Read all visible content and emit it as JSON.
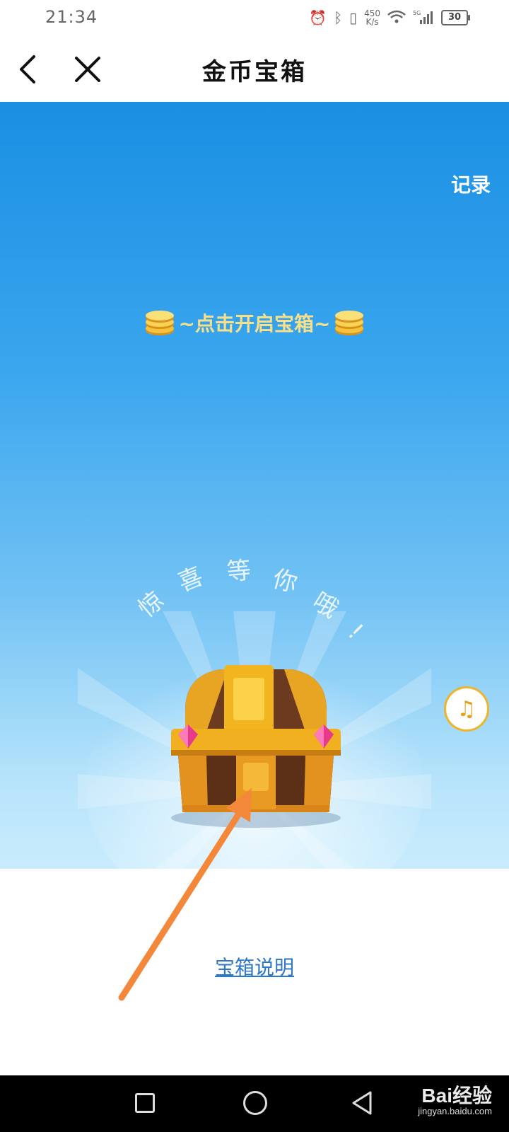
{
  "status_bar": {
    "time": "21:34",
    "net_speed_value": "450",
    "net_speed_unit": "K/s",
    "signal_label": "5G",
    "battery": "30",
    "icons": [
      "alarm-icon",
      "bluetooth-icon",
      "vibrate-icon",
      "wifi-icon",
      "signal-icon",
      "battery-icon"
    ]
  },
  "nav": {
    "title": "金币宝箱",
    "back_icon": "chevron-left-icon",
    "close_icon": "close-icon"
  },
  "hero": {
    "record_label": "记录",
    "prompt": "~点击开启宝箱~",
    "curved_chars": [
      "惊",
      "喜",
      "等",
      "你",
      "哦",
      "!"
    ],
    "music_icon": "music-note-icon",
    "music_glyph": "♫"
  },
  "footer": {
    "description_link": "宝箱说明"
  },
  "system_nav": {
    "items": [
      "recent-apps-icon",
      "home-icon",
      "back-icon"
    ]
  },
  "watermark": {
    "brand": "Bai经验",
    "sub": "jingyan.baidu.com"
  },
  "colors": {
    "hero_top": "#1a8fe3",
    "hero_bottom": "#c9ecfd",
    "prompt_text": "#f8e08a",
    "link": "#2e78c7",
    "arrow": "#f4883a",
    "music_ring": "#f0b429"
  }
}
